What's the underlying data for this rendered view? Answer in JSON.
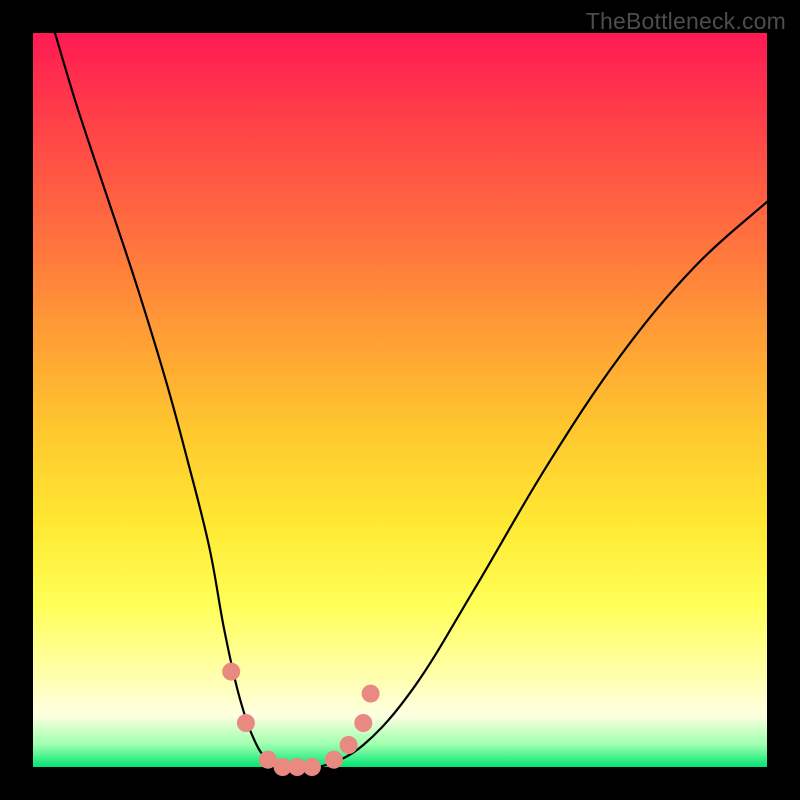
{
  "watermark": "TheBottleneck.com",
  "chart_data": {
    "type": "line",
    "title": "",
    "xlabel": "",
    "ylabel": "",
    "xlim": [
      0,
      100
    ],
    "ylim": [
      0,
      100
    ],
    "grid": false,
    "legend": false,
    "background_gradient": {
      "top": "#ff1a53",
      "mid_upper": "#ff9a36",
      "mid": "#ffe933",
      "mid_lower": "#ffffb1",
      "bottom": "#00e573"
    },
    "series": [
      {
        "name": "bottleneck-curve",
        "color": "#000000",
        "x": [
          3,
          6,
          10,
          14,
          18,
          21,
          24,
          26,
          28,
          30,
          32,
          35,
          39,
          45,
          52,
          60,
          70,
          80,
          90,
          100
        ],
        "values": [
          100,
          90,
          78,
          66,
          53,
          42,
          30,
          19,
          10,
          4,
          1,
          0,
          0,
          3,
          11,
          24,
          41,
          56,
          68,
          77
        ]
      }
    ],
    "markers": {
      "name": "highlight-points",
      "color": "#e98a82",
      "radius_px": 9,
      "points": [
        {
          "x": 27,
          "y": 13
        },
        {
          "x": 29,
          "y": 6
        },
        {
          "x": 32,
          "y": 1
        },
        {
          "x": 34,
          "y": 0
        },
        {
          "x": 36,
          "y": 0
        },
        {
          "x": 38,
          "y": 0
        },
        {
          "x": 41,
          "y": 1
        },
        {
          "x": 43,
          "y": 3
        },
        {
          "x": 45,
          "y": 6
        },
        {
          "x": 46,
          "y": 10
        }
      ]
    }
  }
}
